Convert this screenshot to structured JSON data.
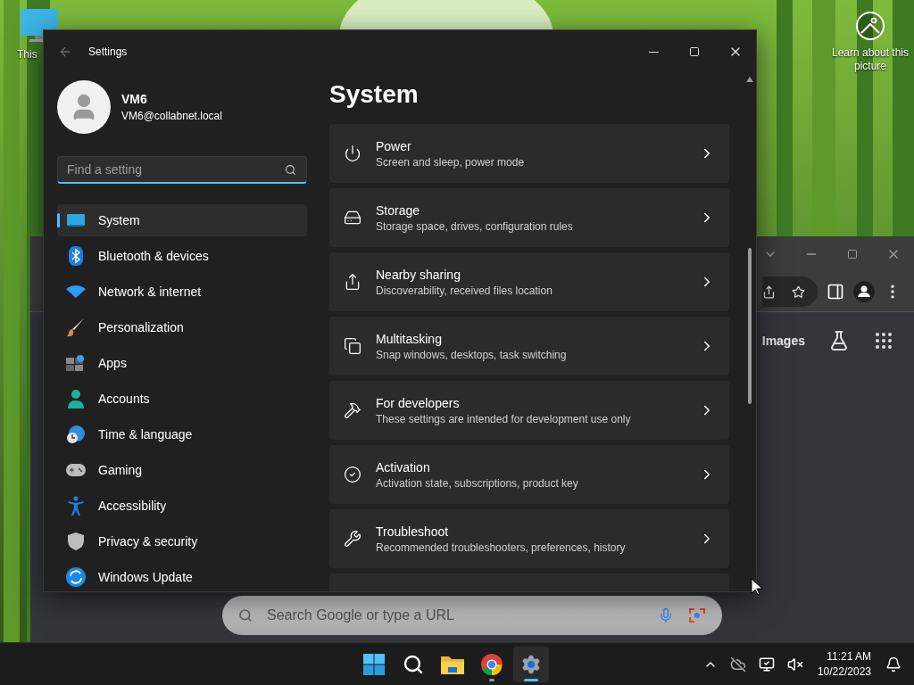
{
  "desktop": {
    "icons": [
      {
        "label": "This"
      }
    ],
    "spotlight": {
      "label": "Learn about this picture"
    }
  },
  "browser_window": {
    "header_links": [
      "Images"
    ],
    "search": {
      "placeholder": "Search Google or type a URL"
    }
  },
  "settings": {
    "title": "Settings",
    "user": {
      "name": "VM6",
      "email": "VM6@collabnet.local"
    },
    "search": {
      "placeholder": "Find a setting"
    },
    "nav": [
      {
        "kind": "system",
        "label": "System",
        "selected": true
      },
      {
        "kind": "bluetooth",
        "label": "Bluetooth & devices",
        "selected": false
      },
      {
        "kind": "network",
        "label": "Network & internet",
        "selected": false
      },
      {
        "kind": "personalization",
        "label": "Personalization",
        "selected": false
      },
      {
        "kind": "apps",
        "label": "Apps",
        "selected": false
      },
      {
        "kind": "accounts",
        "label": "Accounts",
        "selected": false
      },
      {
        "kind": "time",
        "label": "Time & language",
        "selected": false
      },
      {
        "kind": "gaming",
        "label": "Gaming",
        "selected": false
      },
      {
        "kind": "accessibility",
        "label": "Accessibility",
        "selected": false
      },
      {
        "kind": "privacy",
        "label": "Privacy & security",
        "selected": false
      },
      {
        "kind": "update",
        "label": "Windows Update",
        "selected": false
      }
    ],
    "page_title": "System",
    "cards": [
      {
        "kind": "power",
        "title": "Power",
        "description": "Screen and sleep, power mode"
      },
      {
        "kind": "storage",
        "title": "Storage",
        "description": "Storage space, drives, configuration rules"
      },
      {
        "kind": "sharing",
        "title": "Nearby sharing",
        "description": "Discoverability, received files location"
      },
      {
        "kind": "multitasking",
        "title": "Multitasking",
        "description": "Snap windows, desktops, task switching"
      },
      {
        "kind": "developers",
        "title": "For developers",
        "description": "These settings are intended for development use only"
      },
      {
        "kind": "activation",
        "title": "Activation",
        "description": "Activation state, subscriptions, product key"
      },
      {
        "kind": "troubleshoot",
        "title": "Troubleshoot",
        "description": "Recommended troubleshooters, preferences, history"
      }
    ]
  },
  "taskbar": {
    "apps": [
      {
        "kind": "start",
        "running": false,
        "selected": false
      },
      {
        "kind": "search",
        "running": false,
        "selected": false
      },
      {
        "kind": "explorer",
        "running": false,
        "selected": false
      },
      {
        "kind": "chrome",
        "running": true,
        "selected": false
      },
      {
        "kind": "settings",
        "running": true,
        "selected": true
      }
    ],
    "clock": {
      "time": "11:21 AM",
      "date": "10/22/2023"
    }
  }
}
